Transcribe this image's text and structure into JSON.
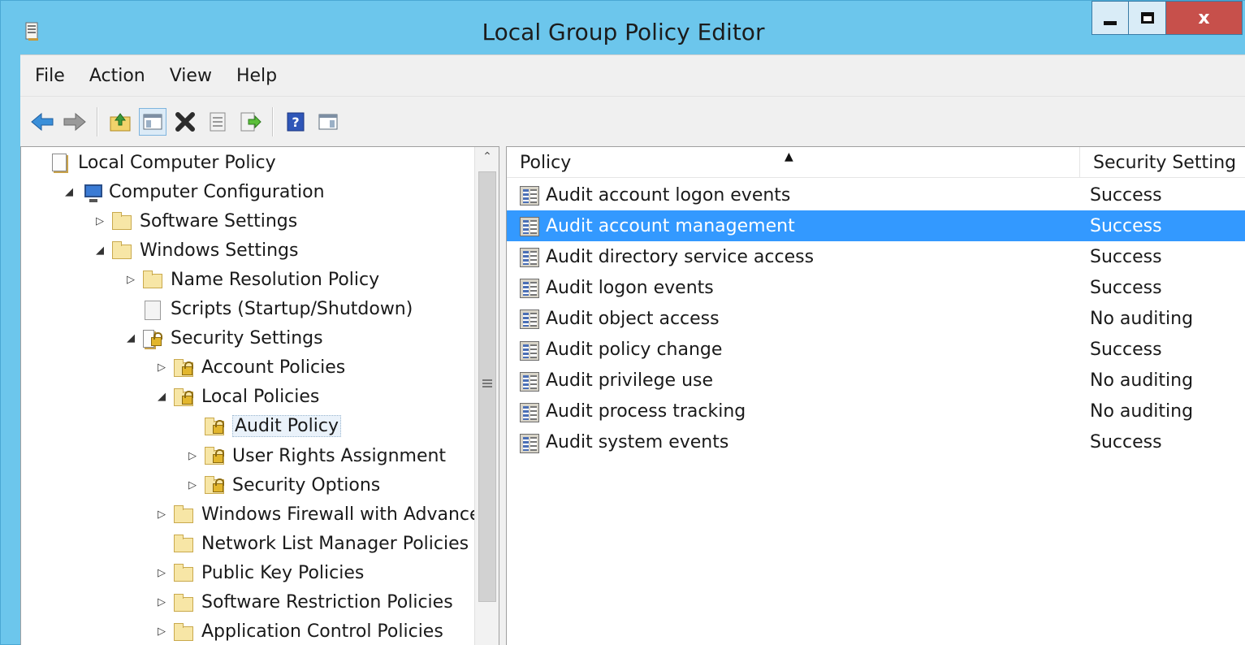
{
  "window": {
    "title": "Local Group Policy Editor",
    "close_glyph": "x"
  },
  "menu": [
    "File",
    "Action",
    "View",
    "Help"
  ],
  "toolbar": {
    "icons": [
      "back-arrow-icon",
      "forward-arrow-icon",
      "up-folder-icon",
      "show-hide-tree-icon",
      "delete-icon",
      "properties-icon",
      "export-list-icon",
      "help-icon",
      "show-hide-action-pane-icon"
    ]
  },
  "tree": {
    "nodes": [
      {
        "label": "Local Computer Policy",
        "expander": "",
        "icon": "policy-doc-icon"
      },
      {
        "label": "Computer Configuration",
        "expander": "◢",
        "icon": "computer-icon"
      },
      {
        "label": "Software Settings",
        "expander": "▷",
        "icon": "folder-icon"
      },
      {
        "label": "Windows Settings",
        "expander": "◢",
        "icon": "folder-icon"
      },
      {
        "label": "Name Resolution Policy",
        "expander": "▷",
        "icon": "folder-icon"
      },
      {
        "label": "Scripts (Startup/Shutdown)",
        "expander": "",
        "icon": "script-icon"
      },
      {
        "label": "Security Settings",
        "expander": "◢",
        "icon": "security-settings-icon"
      },
      {
        "label": "Account Policies",
        "expander": "▷",
        "icon": "locked-folder-icon"
      },
      {
        "label": "Local Policies",
        "expander": "◢",
        "icon": "locked-folder-icon"
      },
      {
        "label": "Audit Policy",
        "expander": "",
        "icon": "locked-folder-icon"
      },
      {
        "label": "User Rights Assignment",
        "expander": "▷",
        "icon": "locked-folder-icon"
      },
      {
        "label": "Security Options",
        "expander": "▷",
        "icon": "locked-folder-icon"
      },
      {
        "label": "Windows Firewall with Advanced",
        "expander": "▷",
        "icon": "folder-icon"
      },
      {
        "label": "Network List Manager Policies",
        "expander": "",
        "icon": "folder-icon"
      },
      {
        "label": "Public Key Policies",
        "expander": "▷",
        "icon": "folder-icon"
      },
      {
        "label": "Software Restriction Policies",
        "expander": "▷",
        "icon": "folder-icon"
      },
      {
        "label": "Application Control Policies",
        "expander": "▷",
        "icon": "folder-icon"
      }
    ]
  },
  "list": {
    "columns": [
      "Policy",
      "Security Setting"
    ],
    "rows": [
      {
        "policy": "Audit account logon events",
        "setting": "Success"
      },
      {
        "policy": "Audit account management",
        "setting": "Success",
        "selected": true
      },
      {
        "policy": "Audit directory service access",
        "setting": "Success"
      },
      {
        "policy": "Audit logon events",
        "setting": "Success"
      },
      {
        "policy": "Audit object access",
        "setting": "No auditing"
      },
      {
        "policy": "Audit policy change",
        "setting": "Success"
      },
      {
        "policy": "Audit privilege use",
        "setting": "No auditing"
      },
      {
        "policy": "Audit process tracking",
        "setting": "No auditing"
      },
      {
        "policy": "Audit system events",
        "setting": "Success"
      }
    ]
  },
  "colors": {
    "titlebar": "#6cc6ec",
    "selection": "#3399ff",
    "close_button": "#c7504b"
  }
}
